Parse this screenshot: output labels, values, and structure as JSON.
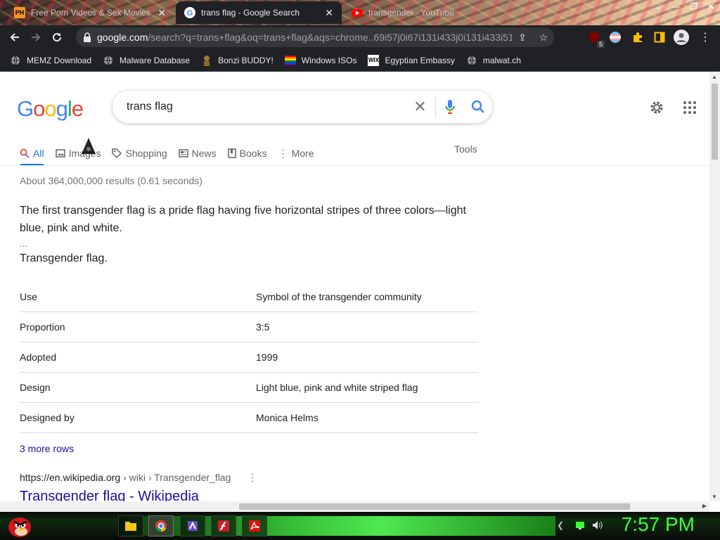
{
  "browser": {
    "tabs": [
      {
        "title": "Free Porn Videos & Sex Movies",
        "favicon": "ph-icon",
        "active": false
      },
      {
        "title": "trans flag - Google Search",
        "favicon": "google-g-icon",
        "active": true
      },
      {
        "title": "transgender - YouTube",
        "favicon": "youtube-icon",
        "active": false
      }
    ],
    "address": {
      "domain": "google.com",
      "path": "/search?q=trans+flag&oq=trans+flag&aqs=chrome..69i57j0i67i131i433j0i131i433i51..."
    },
    "extension_badge": "5",
    "bookmarks": [
      {
        "label": "MEMZ Download",
        "icon": "globe-icon"
      },
      {
        "label": "Malware Database",
        "icon": "globe-icon"
      },
      {
        "label": "Bonzi BUDDY!",
        "icon": "bonzi-icon"
      },
      {
        "label": "Windows ISOs",
        "icon": "rainbow-flag-icon"
      },
      {
        "label": "Egyptian Embassy",
        "icon": "wix-icon"
      },
      {
        "label": "malwat.ch",
        "icon": "globe-icon"
      }
    ]
  },
  "search": {
    "logo": "Google",
    "query": "trans flag",
    "tabs": [
      {
        "label": "All",
        "icon": "search-icon",
        "active": true
      },
      {
        "label": "Images",
        "icon": "image-icon"
      },
      {
        "label": "Shopping",
        "icon": "tag-icon"
      },
      {
        "label": "News",
        "icon": "news-icon"
      },
      {
        "label": "Books",
        "icon": "book-icon"
      },
      {
        "label": "More",
        "icon": "dots-vertical-icon"
      }
    ],
    "tools_label": "Tools",
    "stats": "About 364,000,000 results (0.61 seconds)",
    "snippet": "The first transgender flag is a pride flag having five horizontal stripes of three colors—light blue, pink and white.",
    "ellipsis": "...",
    "snippet_subject": "Transgender flag.",
    "info_rows": [
      {
        "key": "Use",
        "value": "Symbol of the transgender community"
      },
      {
        "key": "Proportion",
        "value": "3:5"
      },
      {
        "key": "Adopted",
        "value": "1999"
      },
      {
        "key": "Design",
        "value": "Light blue, pink and white striped flag"
      },
      {
        "key": "Designed by",
        "value": "Monica Helms"
      }
    ],
    "more_rows": "3 more rows",
    "result_cite_domain": "https://en.wikipedia.org",
    "result_cite_path": " › wiki › Transgender_flag",
    "result_title": "Transgender flag - Wikipedia"
  },
  "taskbar": {
    "clock": "7:57 PM"
  },
  "colors": {
    "google_blue": "#4285f4",
    "google_red": "#ea4335",
    "google_yellow": "#fbbc05",
    "google_green": "#34a853",
    "link": "#1a0dab",
    "clock_green": "#3cff3c"
  }
}
